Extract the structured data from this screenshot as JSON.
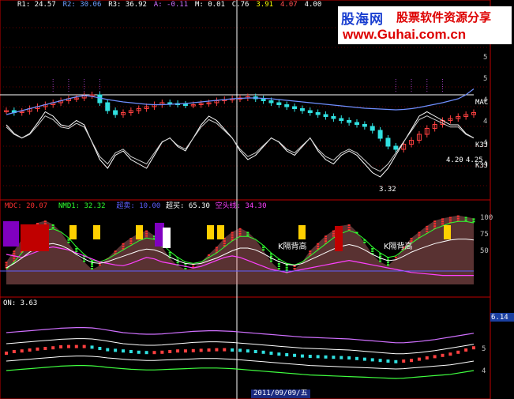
{
  "watermark": {
    "brand": "股海网",
    "slogan": "股票软件资源分享",
    "url": "www.Guhai.com.cn"
  },
  "panel1": {
    "legend": [
      {
        "text": "R1: 24.57",
        "color": "#ffffff"
      },
      {
        "text": "R2: 30.06",
        "color": "#6fa0ff"
      },
      {
        "text": "R3: 36.92",
        "color": "#ffffff"
      },
      {
        "text": "A: -0.11",
        "color": "#d070ff"
      },
      {
        "text": "M: 0.01",
        "color": "#ffffff"
      },
      {
        "text": "C.76",
        "color": "#ffffff"
      },
      {
        "text": "3.91",
        "color": "#ffff00"
      },
      {
        "text": "4.07",
        "color": "#ff5050"
      },
      {
        "text": "4.00",
        "color": "#ffffff"
      }
    ],
    "labels": [
      {
        "text": "MAC",
        "color": "#ffffff"
      },
      {
        "text": "K3J",
        "color": "#ffffff"
      },
      {
        "text": "K3J",
        "color": "#ffffff"
      },
      {
        "text": "4.20",
        "color": "#ffffff"
      },
      {
        "text": "4.25",
        "color": "#ffffff"
      },
      {
        "text": "3.32",
        "color": "#ffffff"
      }
    ]
  },
  "panel2": {
    "legend": [
      {
        "text": "MDC: 20.07",
        "color": "#ff3030"
      },
      {
        "text": "NMD1: 32.32",
        "color": "#30ff30"
      },
      {
        "text": "超卖: 10.00",
        "color": "#5f5fff"
      },
      {
        "text": "超买: 65.30",
        "color": "#ffffff"
      },
      {
        "text": "空头线: 34.30",
        "color": "#ff40ff"
      }
    ],
    "annotations": [
      "K隔背高",
      "K隔背高"
    ]
  },
  "panel3": {
    "legend": [
      {
        "text": "ON: 3.63",
        "color": "#ffffff"
      }
    ]
  },
  "date_readout": "2011/09/09/五",
  "chart_data": [
    {
      "type": "line",
      "title": "main price panel",
      "y_ticks": [
        "6",
        "5",
        "5",
        "4",
        "4",
        "4",
        "4"
      ],
      "series": [
        {
          "name": "close",
          "values": [
            4.3,
            4.25,
            4.28,
            4.35,
            4.4,
            4.45,
            4.5,
            4.55,
            4.6,
            4.62,
            4.68,
            4.7,
            4.5,
            4.3,
            4.2,
            4.25,
            4.3,
            4.35,
            4.4,
            4.45,
            4.5,
            4.48,
            4.46,
            4.44,
            4.45,
            4.48,
            4.5,
            4.55,
            4.58,
            4.6,
            4.62,
            4.65,
            4.6,
            4.55,
            4.5,
            4.45,
            4.4,
            4.35,
            4.3,
            4.25,
            4.2,
            4.15,
            4.1,
            4.05,
            4.0,
            3.95,
            3.9,
            3.8,
            3.6,
            3.4,
            3.32,
            3.45,
            3.55,
            3.7,
            3.85,
            3.95,
            4.05,
            4.1,
            4.15,
            4.2,
            4.25
          ]
        },
        {
          "name": "MA",
          "values": [
            4.2,
            4.25,
            4.3,
            4.35,
            4.4,
            4.45,
            4.5,
            4.55,
            4.6,
            4.65,
            4.68,
            4.66,
            4.62,
            4.58,
            4.55,
            4.52,
            4.5,
            4.48,
            4.46,
            4.45,
            4.45,
            4.46,
            4.47,
            4.48,
            4.5,
            4.52,
            4.54,
            4.56,
            4.58,
            4.6,
            4.61,
            4.62,
            4.62,
            4.61,
            4.6,
            4.58,
            4.56,
            4.54,
            4.52,
            4.5,
            4.48,
            4.46,
            4.44,
            4.42,
            4.4,
            4.38,
            4.36,
            4.35,
            4.34,
            4.33,
            4.32,
            4.33,
            4.35,
            4.38,
            4.42,
            4.46,
            4.5,
            4.55,
            4.6,
            4.7,
            4.85
          ]
        },
        {
          "name": "KDJ-K",
          "values": [
            70,
            60,
            55,
            60,
            72,
            85,
            80,
            70,
            68,
            75,
            70,
            50,
            30,
            20,
            35,
            40,
            30,
            25,
            20,
            35,
            50,
            55,
            45,
            40,
            55,
            70,
            80,
            75,
            65,
            55,
            40,
            30,
            35,
            45,
            55,
            50,
            40,
            35,
            45,
            55,
            40,
            30,
            25,
            35,
            40,
            35,
            25,
            15,
            10,
            20,
            35,
            50,
            65,
            80,
            85,
            80,
            75,
            70,
            70,
            60,
            55
          ]
        }
      ]
    },
    {
      "type": "area",
      "title": "MDC oscillator",
      "y_ticks": [
        "100",
        "75",
        "50"
      ],
      "series": [
        {
          "name": "MDC",
          "values": [
            30,
            45,
            60,
            75,
            82,
            85,
            80,
            70,
            55,
            40,
            30,
            20,
            25,
            35,
            45,
            55,
            62,
            68,
            72,
            65,
            50,
            35,
            25,
            20,
            22,
            30,
            40,
            50,
            62,
            70,
            75,
            70,
            60,
            45,
            30,
            20,
            15,
            20,
            30,
            45,
            55,
            65,
            72,
            78,
            80,
            70,
            55,
            40,
            30,
            25,
            35,
            50,
            62,
            70,
            78,
            85,
            88,
            90,
            92,
            90,
            88
          ]
        },
        {
          "name": "NMD1",
          "values": [
            20,
            30,
            42,
            55,
            65,
            72,
            74,
            70,
            62,
            50,
            40,
            32,
            30,
            34,
            40,
            46,
            52,
            58,
            62,
            60,
            54,
            44,
            36,
            30,
            28,
            30,
            36,
            42,
            50,
            58,
            64,
            64,
            60,
            52,
            42,
            34,
            28,
            26,
            30,
            38,
            46,
            54,
            62,
            68,
            72,
            68,
            60,
            50,
            42,
            36,
            38,
            46,
            55,
            62,
            68,
            74,
            78,
            82,
            84,
            84,
            82
          ]
        },
        {
          "name": "空头线",
          "values": [
            40,
            38,
            36,
            40,
            44,
            48,
            50,
            48,
            46,
            42,
            38,
            34,
            30,
            28,
            26,
            25,
            28,
            32,
            36,
            34,
            30,
            28,
            26,
            24,
            22,
            24,
            28,
            32,
            36,
            38,
            36,
            32,
            28,
            24,
            20,
            18,
            16,
            18,
            20,
            22,
            24,
            26,
            28,
            30,
            32,
            30,
            28,
            26,
            24,
            22,
            20,
            18,
            16,
            15,
            14,
            13,
            12,
            12,
            12,
            12,
            12
          ]
        }
      ]
    },
    {
      "type": "line",
      "title": "ON bands",
      "y_ticks": [
        "6.14",
        "5",
        "4"
      ],
      "series": [
        {
          "name": "price",
          "values": [
            4.45,
            4.5,
            4.52,
            4.55,
            4.58,
            4.6,
            4.62,
            4.65,
            4.66,
            4.66,
            4.66,
            4.64,
            4.6,
            4.56,
            4.54,
            4.52,
            4.5,
            4.48,
            4.47,
            4.47,
            4.48,
            4.5,
            4.52,
            4.52,
            4.53,
            4.54,
            4.55,
            4.56,
            4.56,
            4.55,
            4.54,
            4.52,
            4.5,
            4.48,
            4.45,
            4.42,
            4.4,
            4.38,
            4.36,
            4.35,
            4.34,
            4.33,
            4.32,
            4.31,
            4.3,
            4.28,
            4.26,
            4.24,
            4.22,
            4.2,
            4.18,
            4.2,
            4.22,
            4.26,
            4.3,
            4.34,
            4.38,
            4.42,
            4.48,
            4.55,
            4.62
          ]
        },
        {
          "name": "upper",
          "values": [
            5.1,
            5.12,
            5.14,
            5.16,
            5.18,
            5.2,
            5.22,
            5.24,
            5.25,
            5.26,
            5.26,
            5.25,
            5.22,
            5.18,
            5.14,
            5.1,
            5.08,
            5.06,
            5.05,
            5.05,
            5.06,
            5.08,
            5.1,
            5.12,
            5.14,
            5.15,
            5.16,
            5.16,
            5.15,
            5.14,
            5.12,
            5.1,
            5.08,
            5.06,
            5.04,
            5.02,
            5.0,
            4.98,
            4.96,
            4.95,
            4.94,
            4.93,
            4.92,
            4.91,
            4.9,
            4.88,
            4.86,
            4.84,
            4.82,
            4.8,
            4.78,
            4.78,
            4.8,
            4.82,
            4.85,
            4.88,
            4.92,
            4.96,
            5.0,
            5.04,
            5.08
          ]
        },
        {
          "name": "lower",
          "values": [
            3.9,
            3.92,
            3.94,
            3.96,
            3.98,
            4.0,
            4.02,
            4.04,
            4.05,
            4.06,
            4.06,
            4.05,
            4.03,
            4.0,
            3.98,
            3.96,
            3.94,
            3.93,
            3.92,
            3.92,
            3.93,
            3.94,
            3.95,
            3.96,
            3.97,
            3.98,
            3.98,
            3.98,
            3.97,
            3.96,
            3.94,
            3.92,
            3.9,
            3.88,
            3.86,
            3.84,
            3.82,
            3.8,
            3.78,
            3.76,
            3.75,
            3.74,
            3.73,
            3.72,
            3.71,
            3.7,
            3.69,
            3.68,
            3.67,
            3.66,
            3.65,
            3.66,
            3.68,
            3.7,
            3.72,
            3.74,
            3.76,
            3.78,
            3.82,
            3.86,
            3.9
          ]
        }
      ]
    }
  ]
}
